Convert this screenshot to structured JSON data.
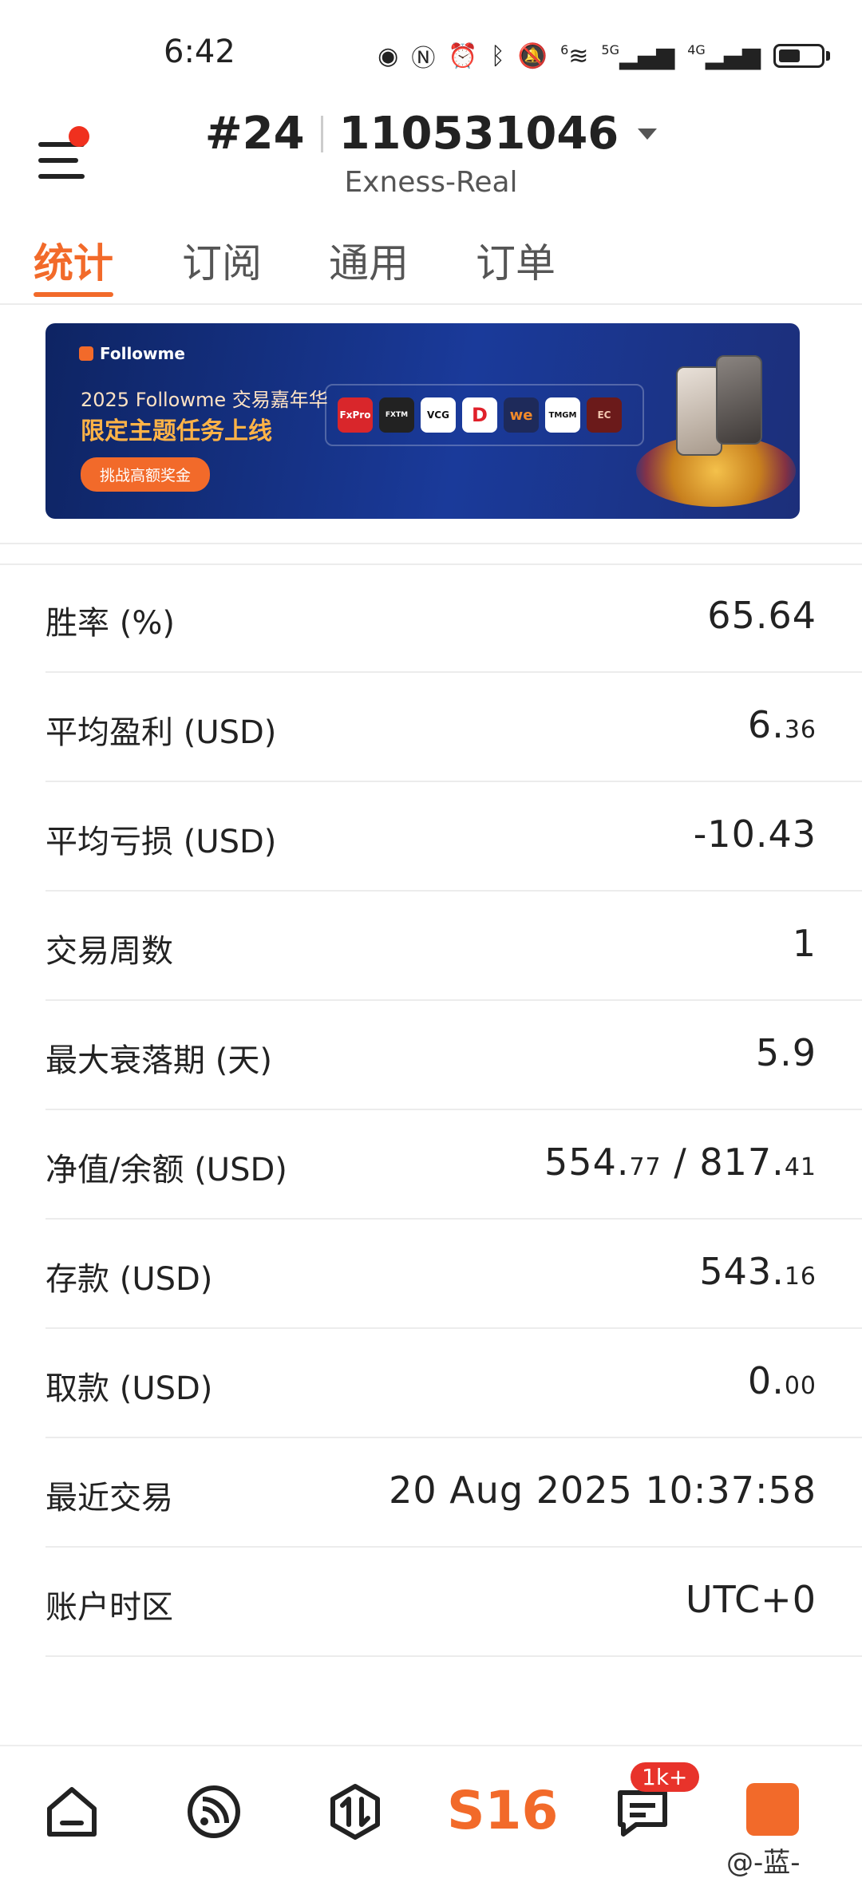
{
  "status_bar": {
    "time": "6:42",
    "icons": [
      "eye-icon",
      "nfc-icon",
      "alarm-icon",
      "bluetooth-icon",
      "mute-icon",
      "wifi-icon",
      "signal-5g-icon",
      "signal-4g-icon",
      "battery-icon"
    ],
    "labels": {
      "net1": "5G",
      "net2": "4G",
      "wifi_sup": "6"
    }
  },
  "header": {
    "account_number_prefix": "#24",
    "account_number": "110531046",
    "server": "Exness-Real"
  },
  "tabs": [
    {
      "label": "统计",
      "active": true
    },
    {
      "label": "订阅",
      "active": false
    },
    {
      "label": "通用",
      "active": false
    },
    {
      "label": "订单",
      "active": false
    }
  ],
  "banner": {
    "brand": "Followme",
    "subtitle": "2025 Followme 交易嘉年华",
    "headline": "限定主题任务上线",
    "cta": "挑战高额奖金",
    "logos": [
      "FxPro",
      "FXTM",
      "VCG",
      "D",
      "we",
      "TMGM",
      "EC"
    ]
  },
  "stats": [
    {
      "label": "胜率 (%)",
      "value": "65.64",
      "decimal": ""
    },
    {
      "label": "平均盈利 (USD)",
      "value": "6.",
      "decimal": "36"
    },
    {
      "label": "平均亏损 (USD)",
      "value": "-10.43",
      "decimal": ""
    },
    {
      "label": "交易周数",
      "value": "1",
      "decimal": ""
    },
    {
      "label": "最大衰落期 (天)",
      "value": "5.9",
      "decimal": ""
    },
    {
      "label": "净值/余额 (USD)",
      "value": "554.",
      "decimal": "77",
      "value2": " / 817.",
      "decimal2": "41"
    },
    {
      "label": "存款 (USD)",
      "value": "543.",
      "decimal": "16"
    },
    {
      "label": "取款 (USD)",
      "value": "0.",
      "decimal": "00"
    },
    {
      "label": "最近交易",
      "value": "20 Aug 2025 10:37:58",
      "decimal": ""
    },
    {
      "label": "账户时区",
      "value": "UTC+0",
      "decimal": ""
    }
  ],
  "bottom_nav": {
    "items": [
      "home-icon",
      "feed-icon",
      "trade-icon",
      "s16",
      "messages-icon",
      "profile-icon"
    ],
    "s16_label": "S16",
    "badge": "1k+",
    "watermark": "@-蓝-"
  },
  "colors": {
    "accent": "#f26a2a",
    "badge": "#e8332b",
    "text": "#222222",
    "divider": "#ececec"
  }
}
